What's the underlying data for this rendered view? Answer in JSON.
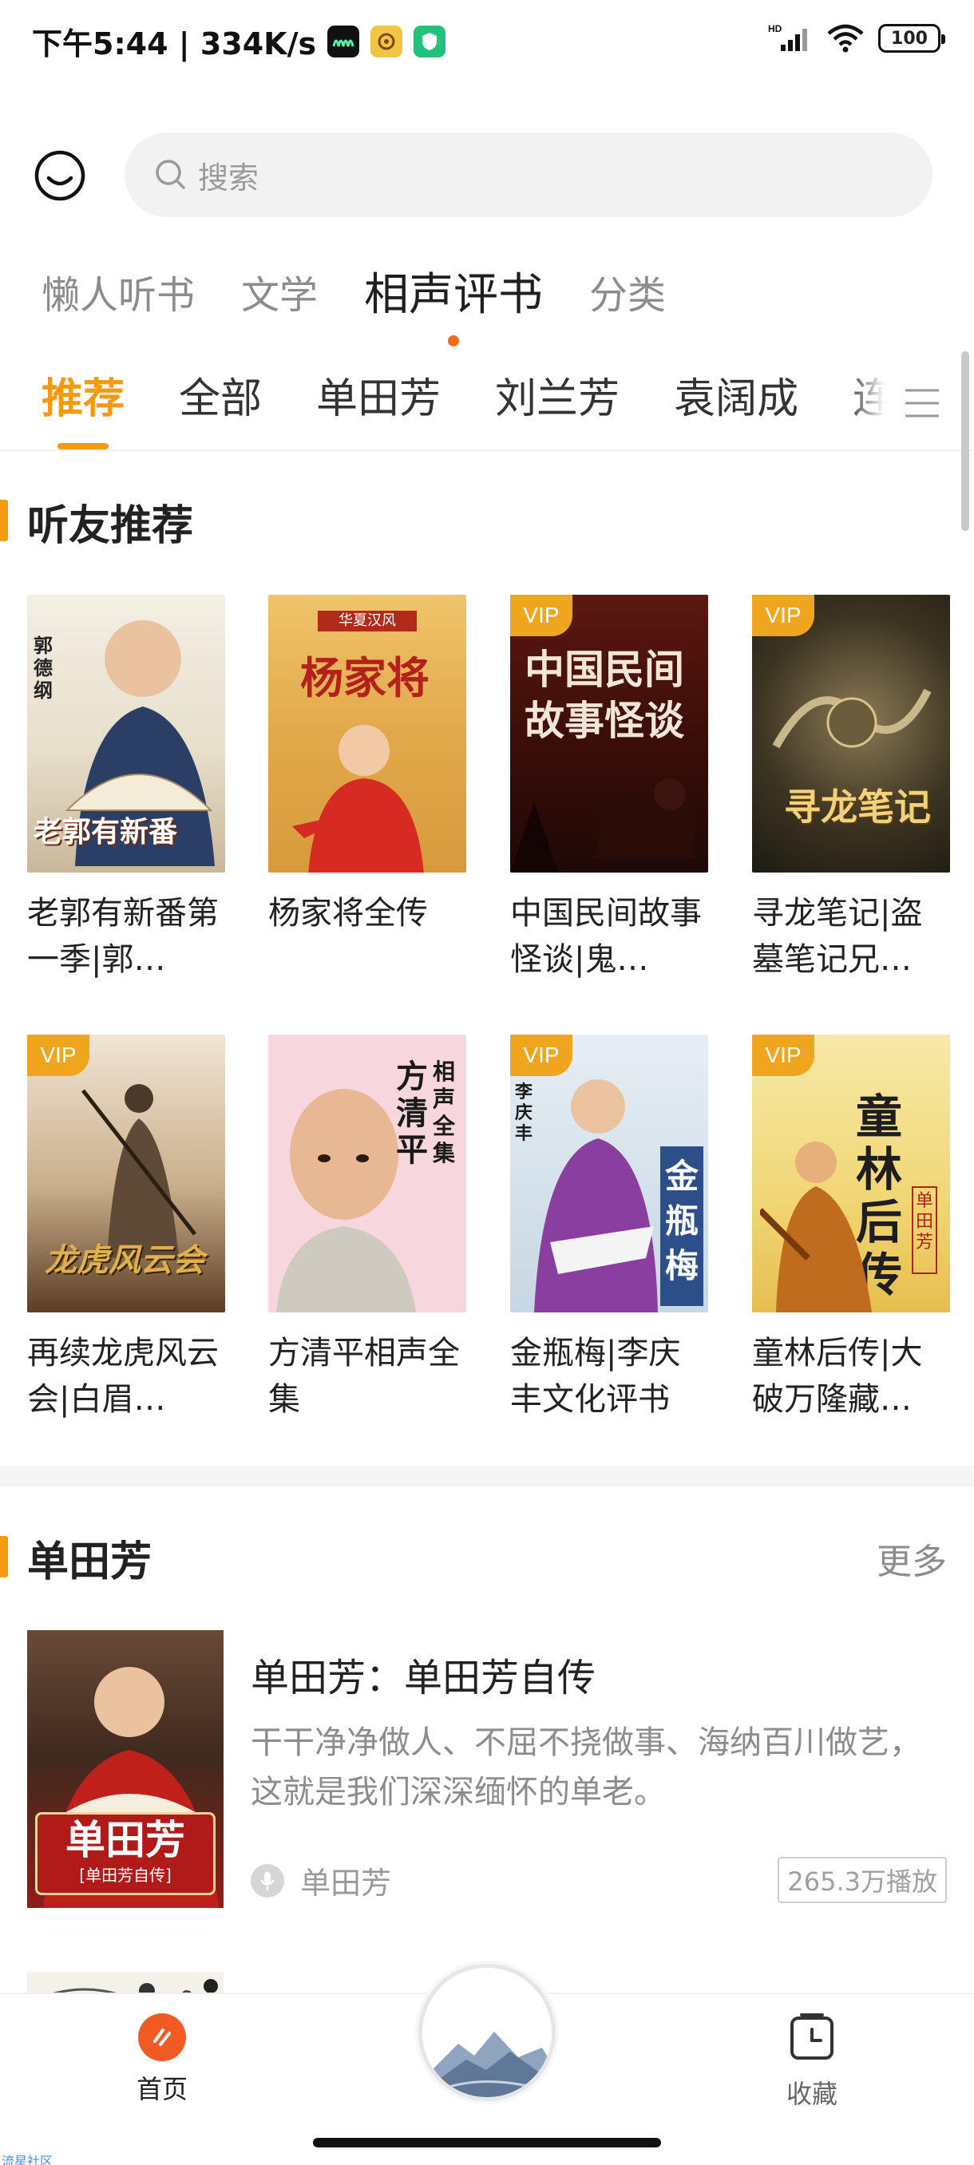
{
  "status_bar": {
    "time": "下午5:44 | 334K/s",
    "battery": "100",
    "network": "HD"
  },
  "search": {
    "placeholder": "搜索"
  },
  "category_tabs": [
    {
      "label": "懒人听书",
      "active": false
    },
    {
      "label": "文学",
      "active": false
    },
    {
      "label": "相声评书",
      "active": true
    },
    {
      "label": "分类",
      "active": false
    }
  ],
  "sub_tabs": [
    {
      "label": "推荐",
      "active": true
    },
    {
      "label": "全部",
      "active": false
    },
    {
      "label": "单田芳",
      "active": false
    },
    {
      "label": "刘兰芳",
      "active": false
    },
    {
      "label": "袁阔成",
      "active": false
    },
    {
      "label": "连",
      "active": false
    }
  ],
  "recommend": {
    "title": "听友推荐",
    "items": [
      {
        "title": "老郭有新番第一季|郭…",
        "vip": false,
        "cover_text": "老郭有新番",
        "cover_side": "郭德纲"
      },
      {
        "title": "杨家将全传",
        "vip": false,
        "cover_text": "杨家将",
        "cover_side": "华夏汉风"
      },
      {
        "title": "中国民间故事怪谈|鬼…",
        "vip": true,
        "cover_text": "中国民间故事怪谈",
        "cover_side": ""
      },
      {
        "title": "寻龙笔记|盗墓笔记兄…",
        "vip": true,
        "cover_text": "寻龙笔记",
        "cover_side": ""
      },
      {
        "title": "再续龙虎风云会|白眉…",
        "vip": true,
        "cover_text": "龙虎风云会",
        "cover_side": ""
      },
      {
        "title": "方清平相声全集",
        "vip": false,
        "cover_text": "方清平",
        "cover_side": "相声全集"
      },
      {
        "title": "金瓶梅|李庆丰文化评书",
        "vip": true,
        "cover_text": "金瓶梅",
        "cover_side": "李庆丰"
      },
      {
        "title": "童林后传|大破万隆藏…",
        "vip": true,
        "cover_text": "童林后传",
        "cover_side": "单田芳"
      }
    ]
  },
  "vip_label": "VIP",
  "shantianfang": {
    "title": "单田芳",
    "more": "更多",
    "item": {
      "title": "单田芳：单田芳自传",
      "description": "干干净净做人、不屈不挠做事、海纳百川做艺，这就是我们深深缅怀的单老。",
      "author": "单田芳",
      "plays": "265.3万播放",
      "cover_text": "单田芳",
      "cover_sub": "[单田芳自传]"
    }
  },
  "bottom_nav": {
    "home": "首页",
    "favorites": "收藏"
  },
  "watermark": "流星社区",
  "colors": {
    "accent": "#f39a10",
    "brand": "#f25a24",
    "vip": "#f0a51e"
  }
}
